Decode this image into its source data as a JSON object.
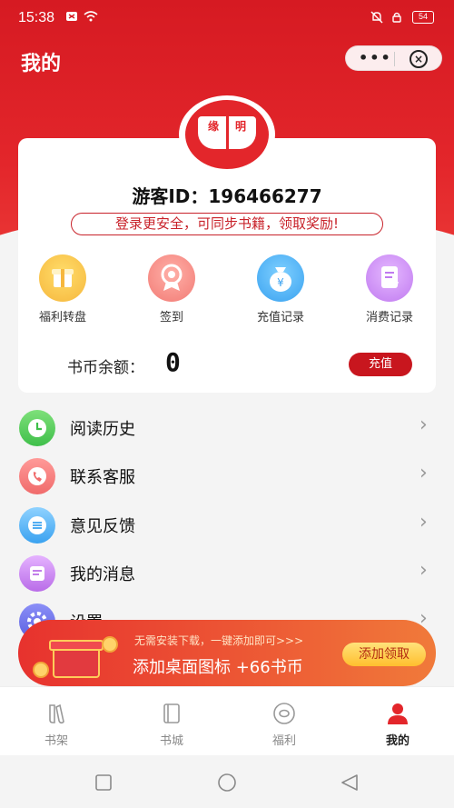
{
  "status_bar": {
    "time": "15:38",
    "battery": "54"
  },
  "header": {
    "title": "我的",
    "capsule_more": "•••",
    "capsule_close": "×"
  },
  "logo": {
    "char_left": "缘",
    "char_right": "明"
  },
  "profile": {
    "visitor_id": "游客ID：196466277",
    "login_tip": "登录更安全，可同步书籍，领取奖励!"
  },
  "quick_actions": [
    {
      "label": "福利转盘",
      "icon": "gift-box-icon"
    },
    {
      "label": "签到",
      "icon": "medal-icon"
    },
    {
      "label": "充值记录",
      "icon": "money-bag-icon"
    },
    {
      "label": "消费记录",
      "icon": "receipt-icon"
    }
  ],
  "balance": {
    "label": "书币余额：",
    "value": "0",
    "recharge_button": "充值"
  },
  "menu": [
    {
      "label": "阅读历史",
      "icon": "clock-icon"
    },
    {
      "label": "联系客服",
      "icon": "phone-icon"
    },
    {
      "label": "意见反馈",
      "icon": "feedback-icon"
    },
    {
      "label": "我的消息",
      "icon": "message-icon"
    },
    {
      "label": "设置",
      "icon": "settings-icon"
    }
  ],
  "promo": {
    "subtitle": "无需安装下载，一键添加即可>>>",
    "title": "添加桌面图标 +66书币",
    "button": "添加领取"
  },
  "tabs": [
    {
      "label": "书架",
      "icon": "bookshelf-icon",
      "active": false
    },
    {
      "label": "书城",
      "icon": "book-icon",
      "active": false
    },
    {
      "label": "福利",
      "icon": "welfare-icon",
      "active": false
    },
    {
      "label": "我的",
      "icon": "person-icon",
      "active": true
    }
  ],
  "colors": {
    "brand_red": "#e3262b",
    "button_red": "#c8161e",
    "promo_button": "#ffbf2e"
  }
}
